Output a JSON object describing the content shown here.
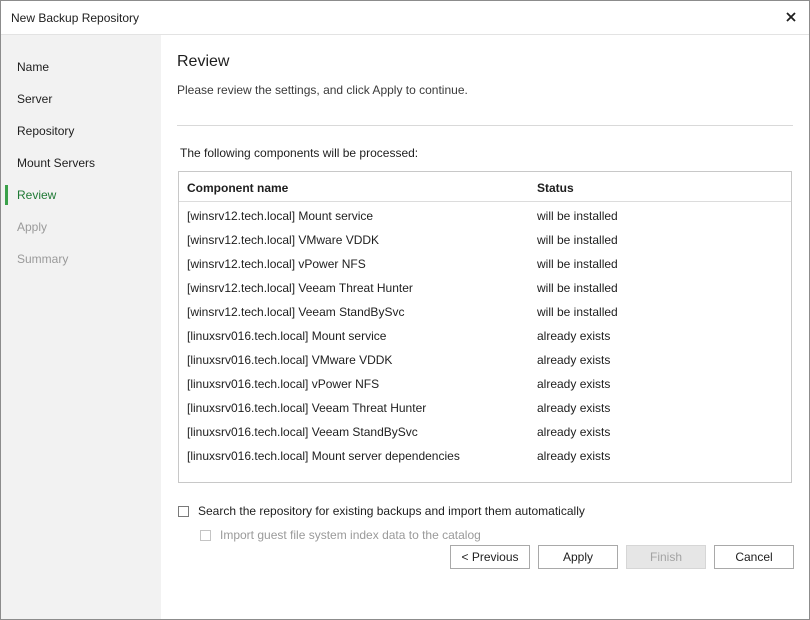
{
  "window": {
    "title": "New Backup Repository",
    "close_icon": "close-icon"
  },
  "steps": [
    {
      "label": "Name",
      "state": "normal"
    },
    {
      "label": "Server",
      "state": "normal"
    },
    {
      "label": "Repository",
      "state": "normal"
    },
    {
      "label": "Mount Servers",
      "state": "normal"
    },
    {
      "label": "Review",
      "state": "active"
    },
    {
      "label": "Apply",
      "state": "disabled"
    },
    {
      "label": "Summary",
      "state": "disabled"
    }
  ],
  "main": {
    "heading": "Review",
    "description": "Please review the settings, and click Apply to continue.",
    "table_caption": "The following components will be processed:",
    "table": {
      "columns": [
        "Component name",
        "Status"
      ],
      "rows": [
        [
          "[winsrv12.tech.local] Mount service",
          "will be installed"
        ],
        [
          "[winsrv12.tech.local] VMware VDDK",
          "will be installed"
        ],
        [
          "[winsrv12.tech.local] vPower NFS",
          "will be installed"
        ],
        [
          "[winsrv12.tech.local] Veeam Threat Hunter",
          "will be installed"
        ],
        [
          "[winsrv12.tech.local] Veeam StandBySvc",
          "will be installed"
        ],
        [
          "[linuxsrv016.tech.local] Mount service",
          "already exists"
        ],
        [
          "[linuxsrv016.tech.local] VMware VDDK",
          "already exists"
        ],
        [
          "[linuxsrv016.tech.local] vPower NFS",
          "already exists"
        ],
        [
          "[linuxsrv016.tech.local] Veeam Threat Hunter",
          "already exists"
        ],
        [
          "[linuxsrv016.tech.local] Veeam StandBySvc",
          "already exists"
        ],
        [
          "[linuxsrv016.tech.local] Mount server dependencies",
          "already exists"
        ]
      ]
    },
    "options": {
      "search_repo": {
        "label": "Search the repository for existing backups and import them automatically",
        "checked": false
      },
      "import_index": {
        "label": "Import guest file system index data to the catalog",
        "checked": false,
        "disabled": true
      }
    }
  },
  "buttons": {
    "previous": "< Previous",
    "apply": "Apply",
    "finish": "Finish",
    "cancel": "Cancel"
  }
}
